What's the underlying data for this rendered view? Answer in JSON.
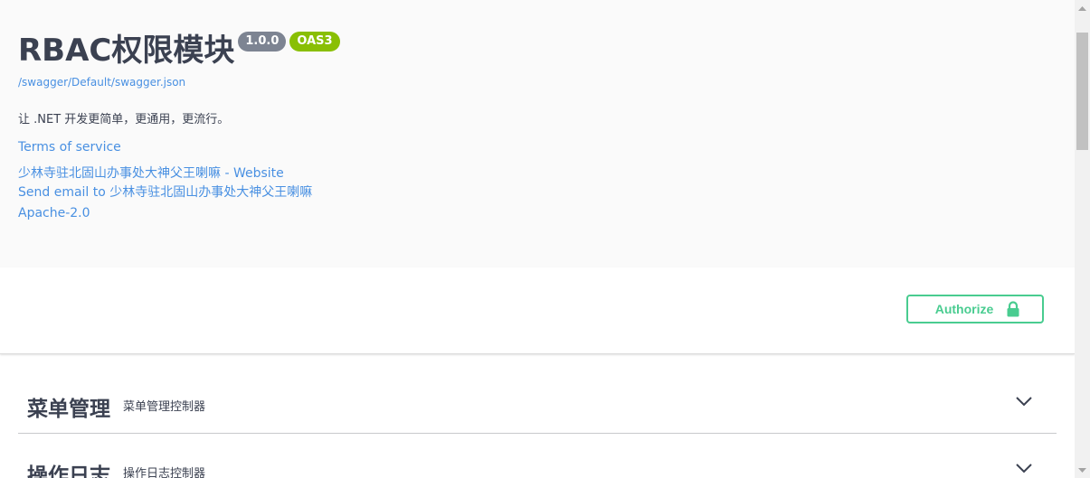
{
  "info": {
    "title": "RBAC权限模块",
    "version": "1.0.0",
    "oas_badge": "OAS3",
    "spec_url": "/swagger/Default/swagger.json",
    "description": "让 .NET 开发更简单，更通用，更流行。",
    "terms_of_service": "Terms of service",
    "contact_website": "少林寺驻北固山办事处大神父王喇嘛 - Website",
    "contact_email": "Send email to 少林寺驻北固山办事处大神父王喇嘛",
    "license": "Apache-2.0"
  },
  "authorize": {
    "label": "Authorize",
    "icon": "lock-icon"
  },
  "tags": [
    {
      "name": "菜单管理",
      "description": "菜单管理控制器"
    },
    {
      "name": "操作日志",
      "description": "操作日志控制器"
    }
  ],
  "colors": {
    "link": "#4990e2",
    "authorize": "#49cc90",
    "version_badge": "#7d8492",
    "oas_badge": "#89bf04",
    "text": "#3b4151"
  }
}
